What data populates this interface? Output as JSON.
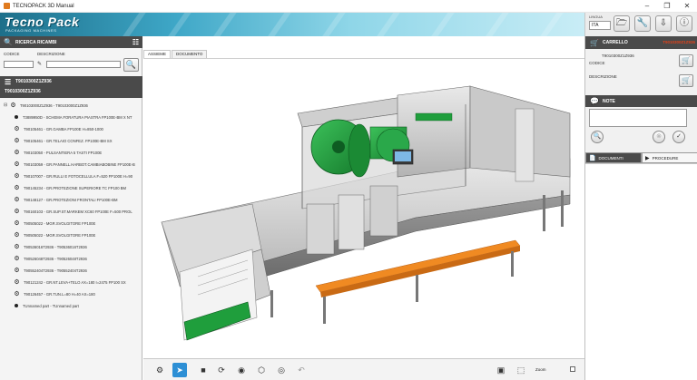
{
  "window": {
    "title": "TECNOPACK 3D Manual",
    "minimize": "–",
    "maximize": "❐",
    "close": "✕"
  },
  "header": {
    "logo": "Tecno Pack",
    "logo_sub": "PACKAGING MACHINES",
    "brand_color": "#2a9fc5"
  },
  "lang": {
    "label": "LINGUA",
    "value": "ITA"
  },
  "tools": [
    "folder-icon",
    "wrench-icon",
    "download-icon",
    "info-icon"
  ],
  "search": {
    "title": "RICERCA RICAMBI",
    "codice_label": "CODICE",
    "descrizione_label": "DESCRIZIONE",
    "codice_value": "",
    "descrizione_value": ""
  },
  "selected": {
    "code_top": "T9010300Z1Z936",
    "code_bottom": "T9010300Z1Z936"
  },
  "tree": [
    {
      "indent": 0,
      "type": "root",
      "text": "T90103000Z1Z936 - T90103000Z1Z936"
    },
    {
      "indent": 1,
      "type": "leaf",
      "text": "T3889950D - SCHEMA FORATURA PIASTRA FP100E-BM X NT"
    },
    {
      "indent": 1,
      "type": "node",
      "text": "T90105461 - GR.GAMBA FP100E H=850-1000"
    },
    {
      "indent": 1,
      "type": "node",
      "text": "T90105461 - GR.TELAIO CONFEZ. FP100E-BM SX"
    },
    {
      "indent": 1,
      "type": "node",
      "text": "T90103050 - PULSANTIERA 5 TASTI FP100E"
    },
    {
      "indent": 1,
      "type": "node",
      "text": "T90103059 - GR.PANNELL.HARBOT.CAMBIABOBINE FP100E-B"
    },
    {
      "indent": 1,
      "type": "node",
      "text": "T90107007 - GR.RULLI E FOTOCELLULA F=520 FP100E H=90"
    },
    {
      "indent": 1,
      "type": "node",
      "text": "T90145234 - GR.PROTEZIONE SUPERIORE TC FP100 BM"
    },
    {
      "indent": 1,
      "type": "node",
      "text": "T90148127 - GR.PROTEZIONI FRONTALI FP100E-BM"
    },
    {
      "indent": 1,
      "type": "node",
      "text": "T90160103 - GR.SUP.ST.MARKEM XC60 FP100E F=500 PROL"
    },
    {
      "indent": 1,
      "type": "node",
      "text": "T90505022 - MGR.SVOLGITORE FP100E"
    },
    {
      "indent": 1,
      "type": "node",
      "text": "T90505022 - MGR.SVOLGITORE FP100E"
    },
    {
      "indent": 1,
      "type": "node",
      "text": "T90536016T2936 - T90536016T2936"
    },
    {
      "indent": 1,
      "type": "node",
      "text": "T90526048T2936 - T90526048T2936"
    },
    {
      "indent": 1,
      "type": "node",
      "text": "T90552404T2936 - T90552404T2936"
    },
    {
      "indent": 1,
      "type": "node",
      "text": "T90121242 - GR.NT.LEVA+TELO AX=180 I=2475 FP100 SX"
    },
    {
      "indent": 1,
      "type": "node",
      "text": "T90126457 - GR.TUN.L=80 H=40 AX=180"
    },
    {
      "indent": 1,
      "type": "leaf",
      "text": "TUnnamed part - TUnnamed part"
    }
  ],
  "tabs": [
    "ASSIEME",
    "DOCUMENTO"
  ],
  "bottom_tools": [
    "exploded-view-icon",
    "pointer-icon",
    "stop-icon",
    "rotate-icon",
    "eye-icon",
    "cube-icon",
    "target-icon",
    "undo-icon"
  ],
  "zoom": {
    "label": "Zoom"
  },
  "cart": {
    "title": "CARRELLO",
    "code": "T9010300Z1Z936",
    "cart_code_line": "T9010300Z1Z936",
    "codice_label": "CODICE",
    "descrizione_label": "DESCRIZIONE"
  },
  "note": {
    "title": "NOTE"
  },
  "doc_tabs": {
    "documenti": "DOCUMENTI",
    "procedure": "PROCEDURE"
  },
  "colors": {
    "accent_green": "#1f9e3c",
    "orange_rail": "#f08a22",
    "dark_bar": "#4a4a4a",
    "active_tool": "#2d8fd5"
  }
}
